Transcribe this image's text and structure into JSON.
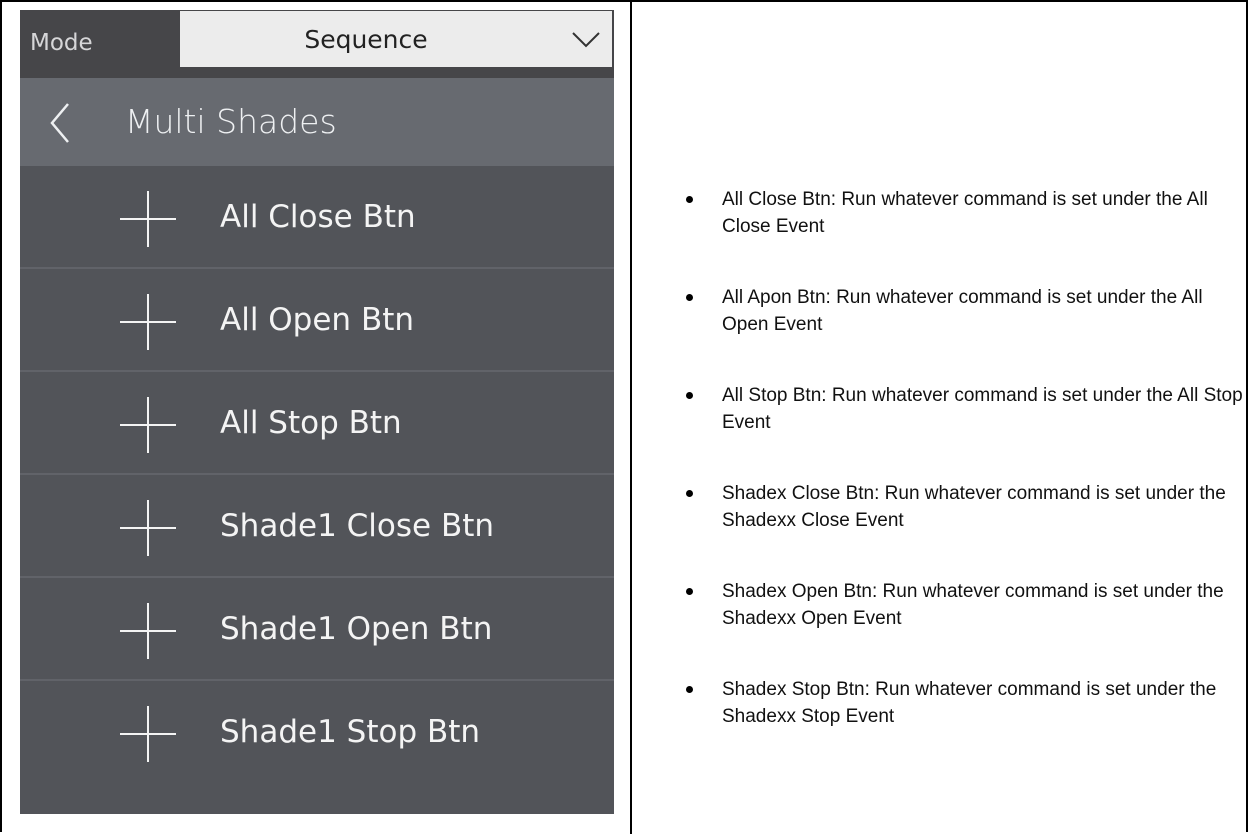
{
  "mode": {
    "label": "Mode",
    "value": "Sequence"
  },
  "header": {
    "title": "Multi Shades"
  },
  "items": [
    {
      "label": "All Close Btn"
    },
    {
      "label": "All Open Btn"
    },
    {
      "label": "All Stop Btn"
    },
    {
      "label": "Shade1 Close Btn"
    },
    {
      "label": "Shade1 Open Btn"
    },
    {
      "label": "Shade1 Stop Btn"
    }
  ],
  "bullets": [
    {
      "text": "All Close Btn: Run whatever command is set under the All Close Event"
    },
    {
      "text": "All Apon Btn: Run whatever command is set under the All Open Event"
    },
    {
      "text": "All Stop Btn: Run whatever command is set under the All Stop Event"
    },
    {
      "text": "Shadex Close Btn: Run whatever command is set under the Shadexx Close Event"
    },
    {
      "text": "Shadex Open Btn: Run whatever command is set under the Shadexx Open Event"
    },
    {
      "text": "Shadex Stop Btn: Run whatever command is set under the Shadexx Stop Event"
    }
  ],
  "icons": {
    "back": "chevron-left-icon",
    "add": "plus-icon",
    "dropdown": "chevron-down-icon"
  },
  "colors": {
    "panel": "#525459",
    "header": "#676a70",
    "mode_bar": "#464649"
  }
}
